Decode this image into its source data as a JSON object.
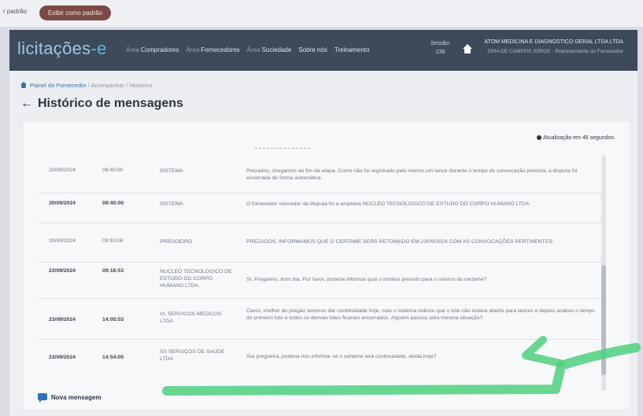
{
  "top": {
    "label": "r padrão",
    "pill": "Exibir como padrão"
  },
  "nav": {
    "logo_main": "licitações",
    "logo_e": "-e",
    "menu": [
      {
        "prefix": "Área",
        "label": "Compradores"
      },
      {
        "prefix": "Área",
        "label": "Fornecedores"
      },
      {
        "prefix": "Área",
        "label": "Sociedade"
      },
      {
        "prefix": "",
        "label": "Sobre nós"
      },
      {
        "prefix": "",
        "label": "Treinamento"
      }
    ],
    "session_label": "Sessão:",
    "session_value": "238",
    "org_name": "ATOM MEDICINA E DIAGNOSTICO GERAL LTDA LTDA",
    "org_sub": "DIRA DE CAMPOS JORGE - Representante do Fornecedor"
  },
  "breadcrumb": {
    "home": "Painel do Fornecedor",
    "rest": " / Acompanhar / Histórico"
  },
  "page_title": "Histórico de mensagens",
  "auto_refresh": "Atualização em 46 segundos",
  "messages": [
    {
      "date": "20/09/2024",
      "time": "09:40:00",
      "author": "SISTEMA",
      "text": "Prezados, chegamos ao fim da etapa. Como não foi registrado pelo menos um lance durante o tempo de convocação prevista, a disputa foi encerrada de forma automática."
    },
    {
      "date": "20/09/2024",
      "time": "09:40:00",
      "author": "SISTEMA",
      "text": "O fornecedor vencedor da disputa foi a empresa NUCLEO TECNOLOGICO DE ESTUDO DO CORPO HUMANO LTDA."
    },
    {
      "date": "20/09/2024",
      "time": "09:53:08",
      "author": "PREGOEIRO",
      "text": "PREZADOS, INFORMAMOS QUE O CERTAME SERÁ RETOMADO EM 23/09/2024 COM AS CONVOCAÇÕES PERTINENTES."
    },
    {
      "date": "23/09/2024",
      "time": "09:16:53",
      "author": "NUCLEO TECNOLOGICO DE ESTUDO DO CORPO HUMANO LTDA.",
      "text": "Sr. Pregoeiro, bom dia. Por favor, poderia informar qual o horário previsto para o retorno do certame?"
    },
    {
      "date": "23/09/2024",
      "time": "14:05:53",
      "author": "VL SERVICOS MEDICOS LTDA",
      "text": "Caros, melhor do pregão teremos dar continuidade hoje, mas o sistema indicou que o lote não estava aberto para lances e depois acabou o tempo do primeiro lote e todos os demais lotes ficaram encerrados. Alguém passou pela mesma situação?"
    },
    {
      "date": "23/09/2024",
      "time": "14:54:05",
      "author": "SS SERVIÇOS DE SAÚDE LTDA",
      "text": "Sra pregoeira, poderia nos informar se o certame terá continuidade, ainda hoje?"
    }
  ],
  "new_message": "Nova mensagem",
  "colors": {
    "nav_bg": "#3c4a5a",
    "accent": "#5fb3e0",
    "annotation": "#4fd07e"
  }
}
